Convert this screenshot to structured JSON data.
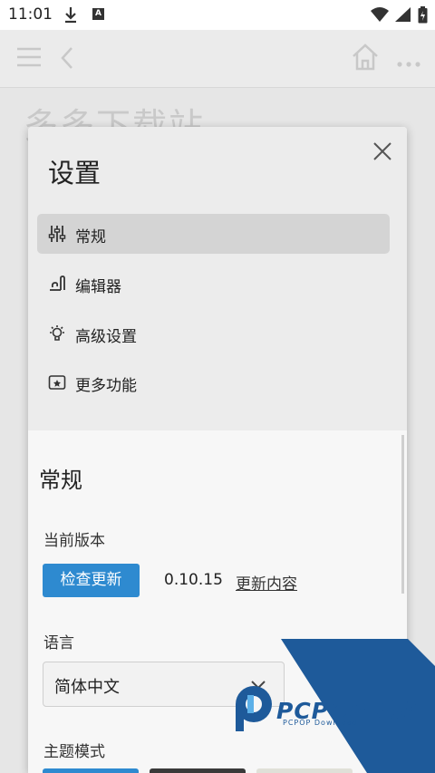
{
  "status_bar": {
    "time": "11:01",
    "badge": "A"
  },
  "background": {
    "title": "多多下载站"
  },
  "dialog": {
    "title": "设置",
    "nav": [
      {
        "label": "常规",
        "icon": "sliders-icon",
        "active": true
      },
      {
        "label": "编辑器",
        "icon": "editor-icon"
      },
      {
        "label": "高级设置",
        "icon": "bulb-icon"
      },
      {
        "label": "更多功能",
        "icon": "image-star-icon"
      }
    ],
    "section_title": "常规",
    "version": {
      "label": "当前版本",
      "check_button": "检查更新",
      "value": "0.10.15",
      "changelog_link": "更新内容"
    },
    "language": {
      "label": "语言",
      "selected": "简体中文"
    },
    "theme": {
      "label": "主题模式"
    }
  },
  "watermark": {
    "brand": "PCPOP下载",
    "sub": "PCPOP Download"
  },
  "colors": {
    "accent": "#2e8ad0",
    "watermark_blue": "#1e5a9a"
  }
}
